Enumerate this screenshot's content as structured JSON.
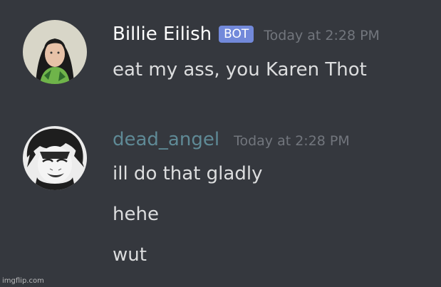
{
  "messages": [
    {
      "username": "Billie Eilish",
      "username_color": "#ffffff",
      "bot_tag": "BOT",
      "timestamp": "Today at 2:28 PM",
      "avatar_icon": "user-avatar-photo",
      "lines": [
        "eat my ass, you Karen Thot"
      ]
    },
    {
      "username": "dead_angel",
      "username_color": "#5f8a96",
      "timestamp": "Today at 2:28 PM",
      "avatar_icon": "anime-avatar",
      "lines": [
        "ill do that gladly",
        "hehe",
        "wut"
      ]
    }
  ],
  "watermark": "imgflip.com"
}
